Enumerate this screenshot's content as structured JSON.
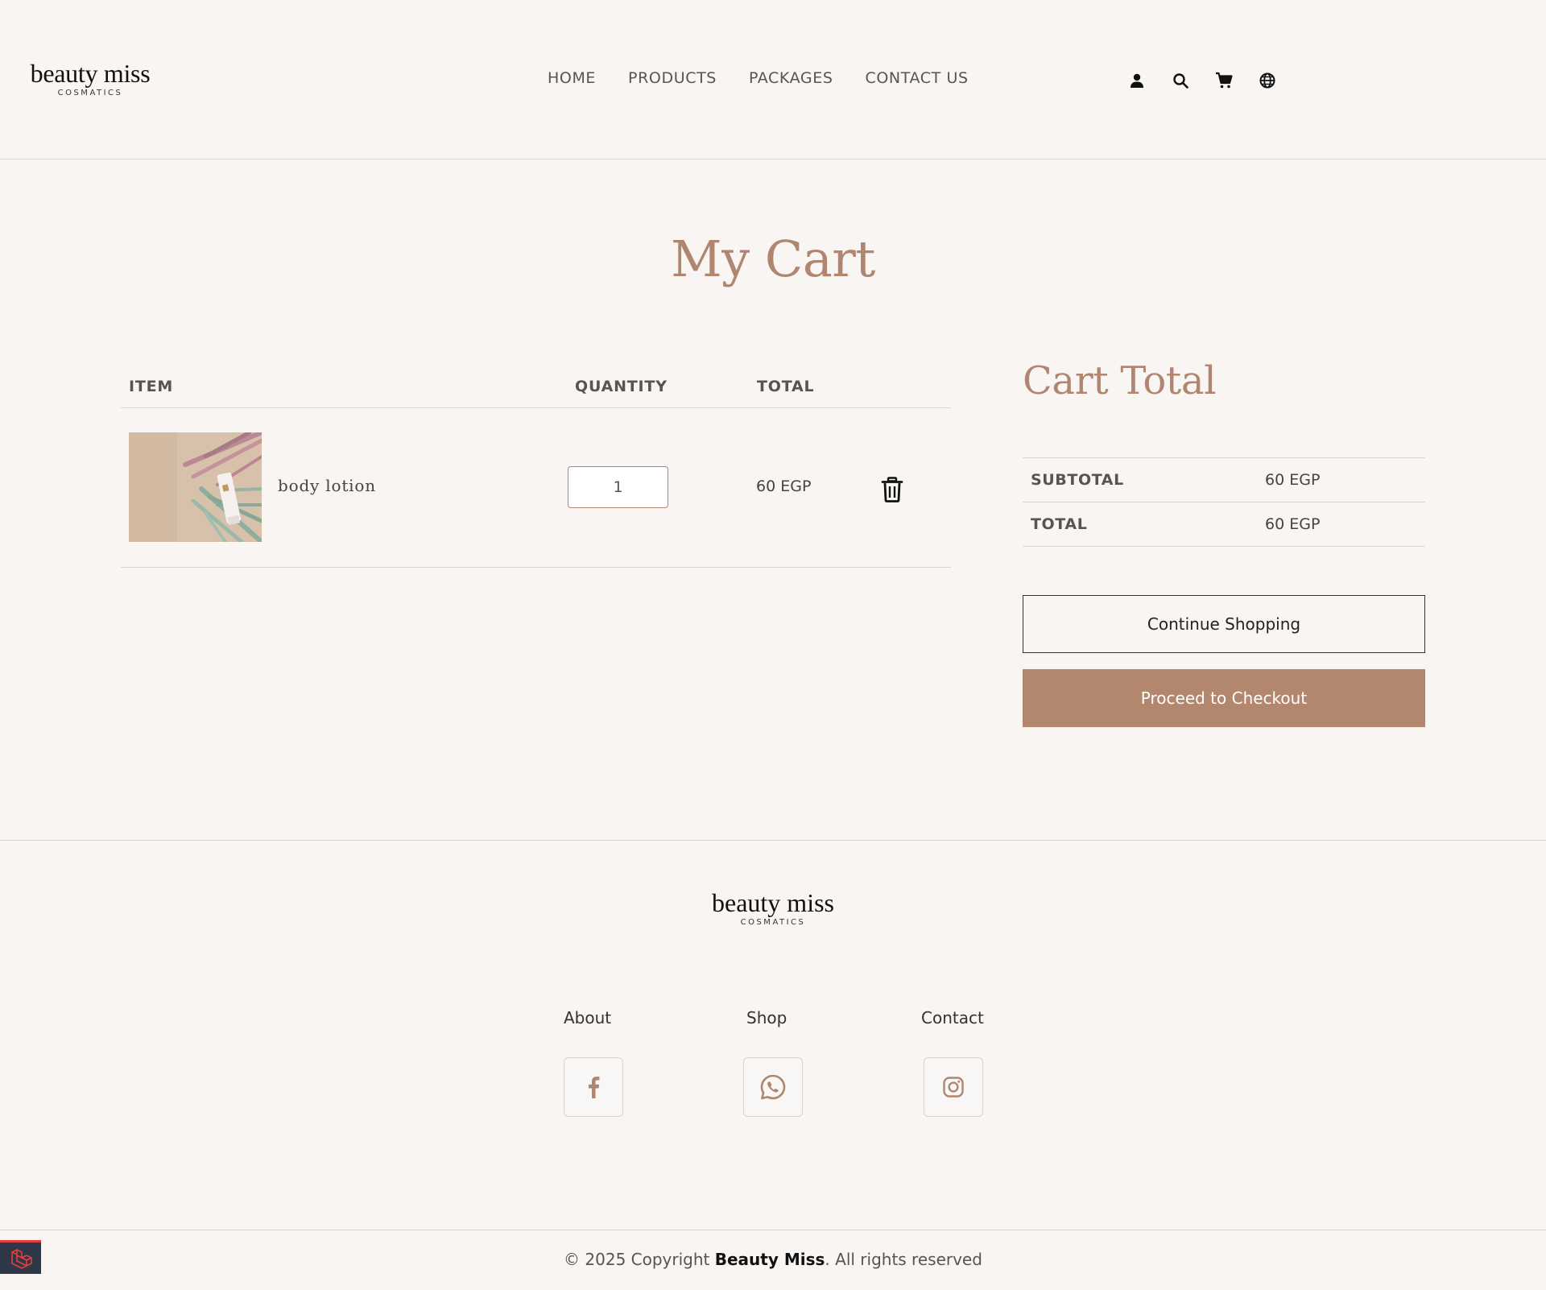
{
  "brand": {
    "name": "beauty miss",
    "tagline": "COSMATICS"
  },
  "nav": {
    "items": [
      "HOME",
      "PRODUCTS",
      "PACKAGES",
      "CONTACT US"
    ]
  },
  "header_icons": [
    "user-icon",
    "search-icon",
    "cart-icon",
    "globe-icon"
  ],
  "page": {
    "title": "My Cart"
  },
  "cart_table": {
    "headers": {
      "item": "ITEM",
      "quantity": "QUANTITY",
      "total": "TOTAL"
    },
    "rows": [
      {
        "name": "body lotion",
        "quantity": "1",
        "total": "60 EGP"
      }
    ]
  },
  "cart_total": {
    "title": "Cart Total",
    "subtotal_label": "SUBTOTAL",
    "subtotal_value": "60 EGP",
    "total_label": "TOTAL",
    "total_value": "60 EGP",
    "continue_label": "Continue Shopping",
    "checkout_label": "Proceed to Checkout"
  },
  "footer": {
    "links": [
      "About",
      "Shop",
      "Contact"
    ],
    "social": [
      "facebook-icon",
      "whatsapp-icon",
      "instagram-icon"
    ],
    "copyright_prefix": "© 2025 Copyright ",
    "copyright_brand": "Beauty Miss",
    "copyright_suffix": ". All rights reserved"
  },
  "colors": {
    "accent": "#b08670",
    "button": "#b3876e",
    "background": "#f8f5f2"
  }
}
